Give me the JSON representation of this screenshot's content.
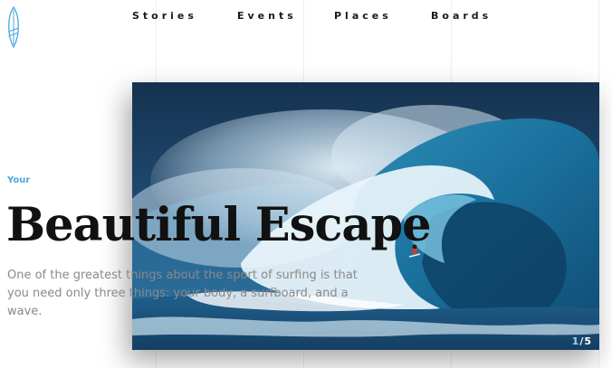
{
  "nav": {
    "items": [
      "Stories",
      "Events",
      "Places",
      "Boards"
    ]
  },
  "hero": {
    "eyebrow": "Your",
    "title": "Beautiful Escape",
    "description": "One of the greatest things about the sport of surfing is that you need only three things: your body, a surfboard, and a wave.",
    "slide_current": "1",
    "slide_separator": "/",
    "slide_total": "5"
  },
  "logo": {
    "icon": "surfboard-icon"
  },
  "colors": {
    "accent": "#4aa6dd",
    "title": "#111111",
    "body_text": "#8a8a8a"
  }
}
